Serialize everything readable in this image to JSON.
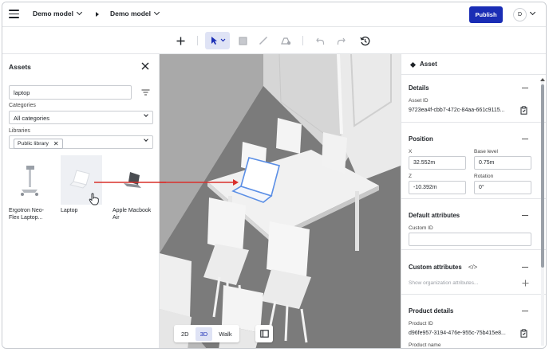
{
  "topbar": {
    "crumb1": "Demo model",
    "crumb2": "Demo model",
    "publish_label": "Publish",
    "avatar_initial": "D"
  },
  "assets_panel": {
    "title": "Assets",
    "search_value": "laptop",
    "categories_label": "Categories",
    "categories_value": "All categories",
    "libraries_label": "Libraries",
    "library_chip": "Public library",
    "items": [
      {
        "name": "Ergotron Neo-Flex Laptop..."
      },
      {
        "name": "Laptop"
      },
      {
        "name": "Apple Macbook Air"
      }
    ]
  },
  "viewport": {
    "modes": [
      "2D",
      "3D",
      "Walk"
    ],
    "active_mode": "3D"
  },
  "properties": {
    "title": "Asset",
    "details": {
      "title": "Details",
      "asset_id_label": "Asset ID",
      "asset_id_value": "9723ea4f-cbb7-472c-84aa-661c9115..."
    },
    "position": {
      "title": "Position",
      "x_label": "X",
      "x_value": "32.552m",
      "base_label": "Base level",
      "base_value": "0.75m",
      "z_label": "Z",
      "z_value": "-10.392m",
      "rotation_label": "Rotation",
      "rotation_value": "0°"
    },
    "default_attributes": {
      "title": "Default attributes",
      "custom_id_label": "Custom ID",
      "custom_id_value": ""
    },
    "custom_attributes": {
      "title": "Custom attributes",
      "code_glyph": "</>",
      "placeholder": "Show organization attributes..."
    },
    "product_details": {
      "title": "Product details",
      "product_id_label": "Product ID",
      "product_id_value": "d96fe957-3194-476e-955c-75b415e8...",
      "product_name_label": "Product name"
    }
  },
  "colors": {
    "accent": "#1a2db5",
    "active_bg": "#dfe3f5",
    "arrow": "#d9302c"
  }
}
